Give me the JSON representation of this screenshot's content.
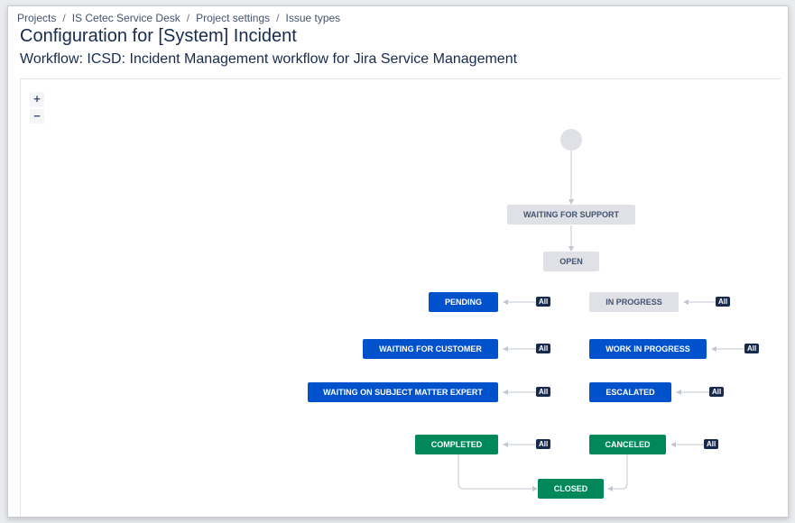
{
  "breadcrumb": {
    "items": [
      "Projects",
      "IS Cetec Service Desk",
      "Project settings",
      "Issue types"
    ],
    "separator": "/"
  },
  "page": {
    "title": "Configuration for [System] Incident",
    "subtitle": "Workflow: ICSD: Incident Management workflow for Jira Service Management"
  },
  "zoom": {
    "in": "+",
    "out": "−"
  },
  "workflow": {
    "statuses": {
      "waiting_for_support": "WAITING FOR SUPPORT",
      "open": "OPEN",
      "pending": "PENDING",
      "in_progress": "IN PROGRESS",
      "waiting_for_customer": "WAITING FOR CUSTOMER",
      "work_in_progress": "WORK IN PROGRESS",
      "waiting_on_sme": "WAITING ON SUBJECT MATTER EXPERT",
      "escalated": "ESCALATED",
      "completed": "COMPLETED",
      "canceled": "CANCELED",
      "closed": "CLOSED"
    },
    "all_label": "All"
  },
  "colors": {
    "in_progress_blue": "#0052cc",
    "todo_grey": "#dfe1e6",
    "done_green": "#00875a",
    "all_badge": "#172b4d"
  }
}
